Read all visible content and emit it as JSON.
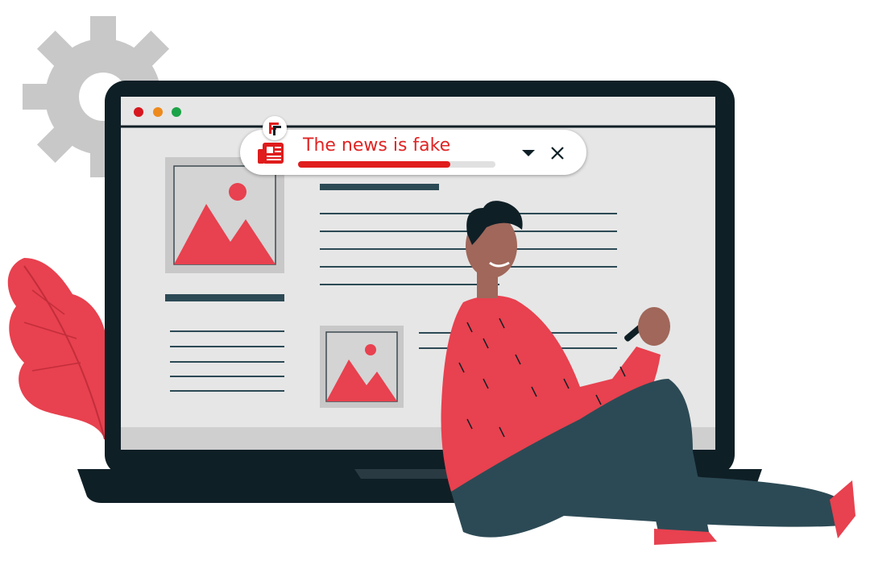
{
  "alert": {
    "headline": "The news is fake",
    "fake_level": 0.77,
    "icon": "newspaper-icon",
    "actions": [
      "chevron-down-icon",
      "close-icon"
    ]
  },
  "brand": {
    "icon": "logo-f-icon"
  },
  "colors": {
    "accent": "#e8414f",
    "alert_red": "#e01c1c",
    "dark": "#0f1f26",
    "screen_bg": "#e6e6e6",
    "text_lines": "#2c4a55"
  }
}
